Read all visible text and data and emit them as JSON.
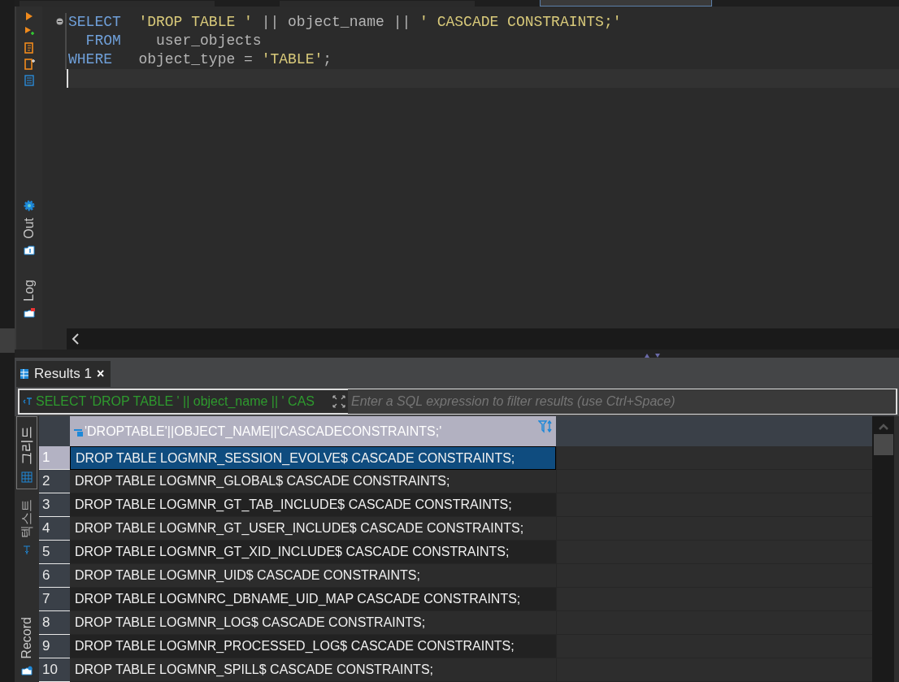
{
  "editor_tabs": [
    {
      "selected": false
    },
    {
      "selected": false
    },
    {
      "selected": true
    }
  ],
  "side_panel": {
    "labels": [
      "Out",
      "Log"
    ]
  },
  "editor": {
    "lines": [
      [
        {
          "kind": "keyword",
          "text": "SELECT"
        },
        {
          "kind": "string",
          "text": "  'DROP TABLE '"
        },
        {
          "kind": "plain",
          "text": " || object_name || "
        },
        {
          "kind": "string",
          "text": "' CASCADE CONSTRAINTS;'"
        }
      ],
      [
        {
          "kind": "keyword",
          "text": "  FROM"
        },
        {
          "kind": "plain",
          "text": "    user_objects"
        }
      ],
      [
        {
          "kind": "keyword",
          "text": "WHERE"
        },
        {
          "kind": "plain",
          "text": "   object_type = "
        },
        {
          "kind": "string",
          "text": "'TABLE'"
        },
        {
          "kind": "plain",
          "text": ";"
        }
      ]
    ]
  },
  "results": {
    "tab": {
      "label": "Results 1",
      "close": "×"
    },
    "filter": {
      "value": "SELECT 'DROP TABLE ' || object_name || ' CAS",
      "placeholder": "Enter a SQL expression to filter results (use Ctrl+Space)"
    },
    "view_tabs": [
      {
        "label": "그리드",
        "selected": true
      },
      {
        "label": "텍스트",
        "selected": false
      }
    ],
    "record_label": "Record",
    "columns": [
      "'DROPTABLE'||OBJECT_NAME||'CASCADECONSTRAINTS;'"
    ],
    "rows": [
      {
        "num": "1",
        "value": "DROP TABLE LOGMNR_SESSION_EVOLVE$ CASCADE CONSTRAINTS;",
        "selected": true
      },
      {
        "num": "2",
        "value": "DROP TABLE LOGMNR_GLOBAL$ CASCADE CONSTRAINTS;",
        "selected": false
      },
      {
        "num": "3",
        "value": "DROP TABLE LOGMNR_GT_TAB_INCLUDE$ CASCADE CONSTRAINTS;",
        "selected": false
      },
      {
        "num": "4",
        "value": "DROP TABLE LOGMNR_GT_USER_INCLUDE$ CASCADE CONSTRAINTS;",
        "selected": false
      },
      {
        "num": "5",
        "value": "DROP TABLE LOGMNR_GT_XID_INCLUDE$ CASCADE CONSTRAINTS;",
        "selected": false
      },
      {
        "num": "6",
        "value": "DROP TABLE LOGMNR_UID$ CASCADE CONSTRAINTS;",
        "selected": false
      },
      {
        "num": "7",
        "value": "DROP TABLE LOGMNRC_DBNAME_UID_MAP CASCADE CONSTRAINTS;",
        "selected": false
      },
      {
        "num": "8",
        "value": "DROP TABLE LOGMNR_LOG$ CASCADE CONSTRAINTS;",
        "selected": false
      },
      {
        "num": "9",
        "value": "DROP TABLE LOGMNR_PROCESSED_LOG$ CASCADE CONSTRAINTS;",
        "selected": false
      },
      {
        "num": "10",
        "value": "DROP TABLE LOGMNR_SPILL$ CASCADE CONSTRAINTS;",
        "selected": false
      }
    ]
  }
}
